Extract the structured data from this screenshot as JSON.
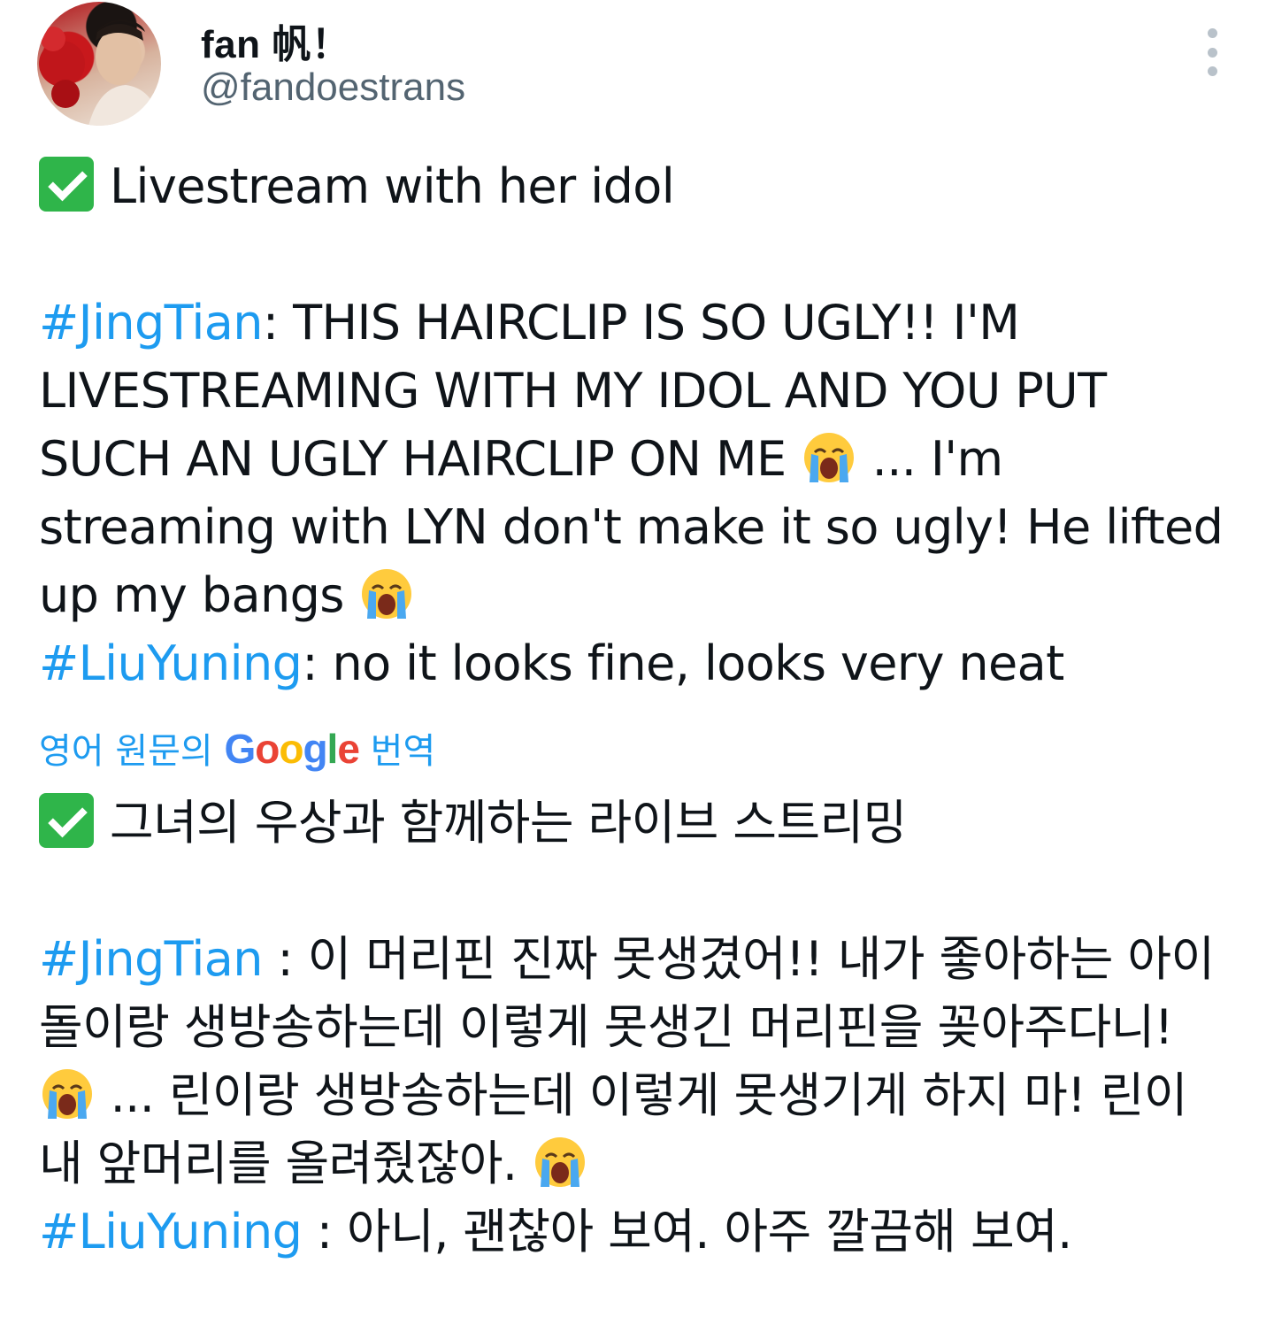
{
  "author": {
    "name": "fan 帆！",
    "handle": "@fandoestrans"
  },
  "icons": {
    "check": "white-heavy-check-mark-emoji",
    "cry": "loudly-crying-face-emoji",
    "more": "more-options-icon"
  },
  "original": {
    "line1": "Livestream with her idol",
    "jt_tag": "#JingTian",
    "jt_text": ": THIS HAIRCLIP IS SO UGLY!! I'M LIVESTREAMING WITH MY IDOL AND YOU PUT SUCH AN UGLY HAIRCLIP ON ME",
    "jt_text2": " ... I'm streaming with LYN don't make it so ugly! He lifted up my bangs",
    "ly_tag": "#LiuYuning",
    "ly_text": ": no it looks fine, looks very neat"
  },
  "translation_notice": {
    "prefix": "영어 원문의",
    "google": "Google",
    "suffix": "번역"
  },
  "translated": {
    "line1": "그녀의 우상과 함께하는 라이브 스트리밍",
    "jt_tag": "#JingTian",
    "jt_text": " : 이 머리핀 진짜 못생겼어!! 내가 좋아하는 아이돌이랑 생방송하는데 이렇게 못생긴 머리핀을 꽂아주다니!",
    "jt_text2": " ... 린이랑 생방송하는데 이렇게 못생기게 하지 마! 린이 내 앞머리를 올려줬잖아.",
    "ly_tag": "#LiuYuning",
    "ly_text": " : 아니, 괜찮아 보여. 아주 깔끔해 보여."
  },
  "colors": {
    "link": "#1d9bf0",
    "text": "#0f1419",
    "secondary": "#536471"
  }
}
